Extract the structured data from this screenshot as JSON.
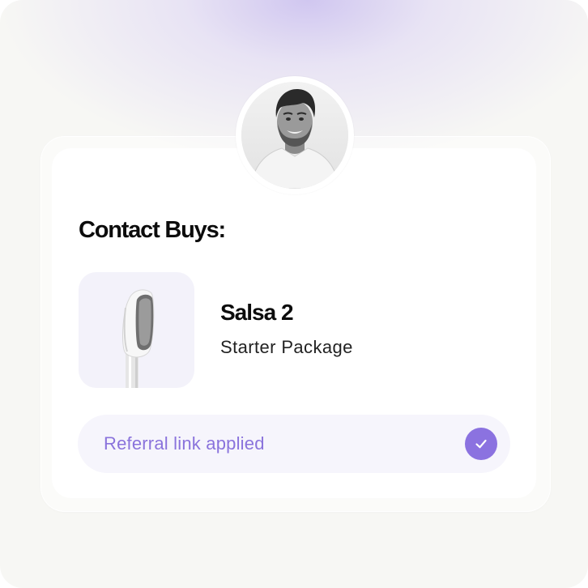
{
  "heading": "Contact Buys:",
  "product": {
    "name": "Salsa 2",
    "package": "Starter Package",
    "image_icon": "salsa-device-icon"
  },
  "referral": {
    "label": "Referral link applied",
    "status_icon": "check-circle-icon"
  },
  "avatar": {
    "icon": "avatar"
  },
  "colors": {
    "accent": "#8b72e0",
    "accent_text": "#8a73dc",
    "referral_bg": "#f6f5fc",
    "thumb_bg": "#f3f2fa"
  }
}
